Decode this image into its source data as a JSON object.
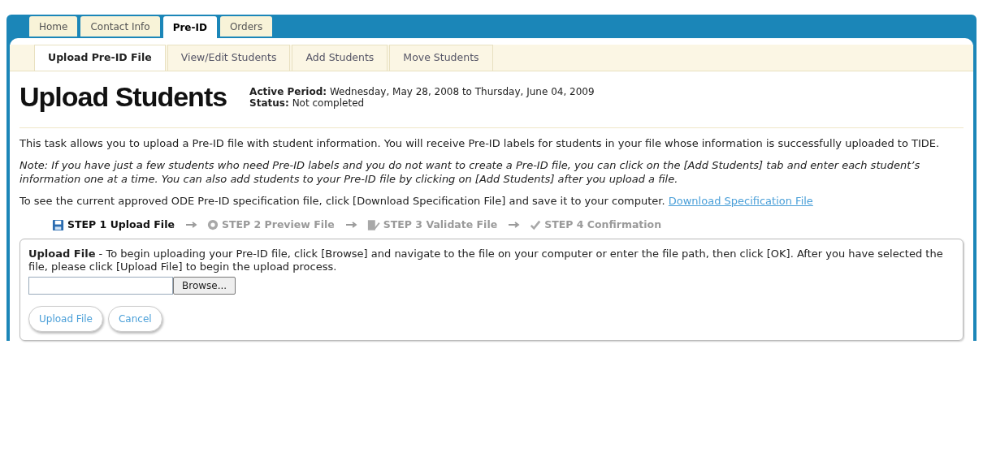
{
  "top_tabs": [
    {
      "label": "Home",
      "selected": false
    },
    {
      "label": "Contact Info",
      "selected": false
    },
    {
      "label": "Pre-ID",
      "selected": true
    },
    {
      "label": "Orders",
      "selected": false
    }
  ],
  "sub_tabs": [
    {
      "label": "Upload Pre-ID File",
      "selected": true
    },
    {
      "label": "View/Edit Students",
      "selected": false
    },
    {
      "label": "Add Students",
      "selected": false
    },
    {
      "label": "Move Students",
      "selected": false
    }
  ],
  "header": {
    "title": "Upload Students",
    "active_period_label": "Active Period:",
    "active_period": "Wednesday, May 28, 2008 to Thursday, June 04, 2009",
    "status_label": "Status:",
    "status": "Not completed"
  },
  "intro": "This task allows you to upload a Pre-ID file with student information. You will receive Pre-ID labels for students in your file whose information is successfully uploaded to TIDE.",
  "note": "Note: If you have just a few students who need Pre-ID labels and you do not want to create a Pre-ID file, you can click on the [Add Students] tab and enter each student’s information one at a time. You can also add students to your Pre-ID file by clicking on [Add Students] after you upload a file.",
  "spec": {
    "text": "To see the current approved ODE Pre-ID specification file, click [Download Specification File] and save it to your computer.",
    "link": "Download Specification File"
  },
  "steps": [
    {
      "kind": "save",
      "label": "STEP 1 Upload File",
      "active": true
    },
    {
      "kind": "preview",
      "label": "STEP 2 Preview File",
      "active": false
    },
    {
      "kind": "validate",
      "label": "STEP 3 Validate File",
      "active": false
    },
    {
      "kind": "confirm",
      "label": "STEP 4 Confirmation",
      "active": false
    }
  ],
  "upload": {
    "title": "Upload File",
    "instructions": " - To begin uploading your Pre-ID file, click [Browse] and navigate to the file on your computer or enter the file path, then click [OK]. After you have selected the file, please click [Upload File] to begin the upload process.",
    "browse": "Browse...",
    "buttons": [
      "Upload File",
      "Cancel"
    ]
  }
}
